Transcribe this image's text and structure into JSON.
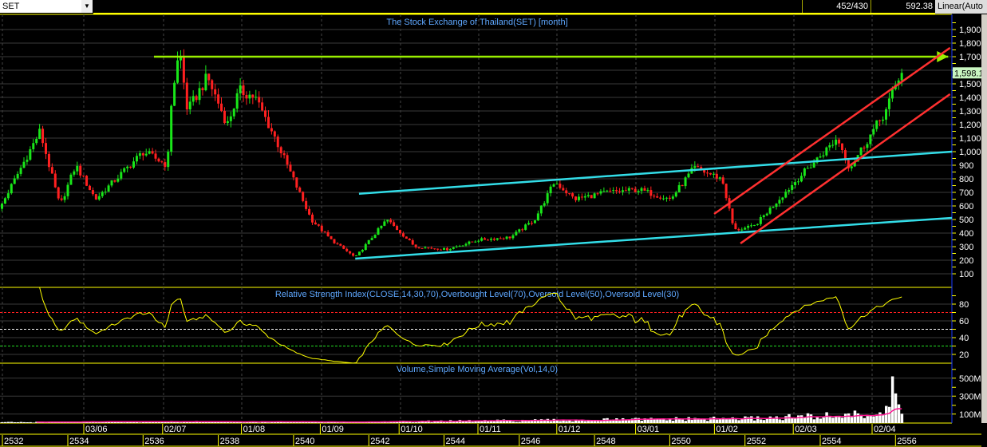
{
  "toolbar": {
    "symbol": "SET",
    "bars": "452/430",
    "value": "592.38",
    "scale": "Linear(Auto"
  },
  "colors": {
    "up": "#19e619",
    "down": "#ff2020",
    "grid": "#3a3a3a",
    "axis": "#ffff00",
    "trend_green": "#99ee00",
    "trend_cyan": "#33dde8",
    "trend_red": "#ff3030",
    "rsi": "#ffff00",
    "sma": "#ff1493"
  },
  "chart_data": [
    {
      "type": "candlestick",
      "title": "The Stock Exchange of Thailand(SET) [month]",
      "ylim": [
        0,
        1950
      ],
      "yticks": [
        "100",
        "200",
        "300",
        "400",
        "500",
        "600",
        "700",
        "800",
        "900",
        "1,000",
        "1,100",
        "1,200",
        "1,300",
        "1,400",
        "1,500",
        "1,600",
        "1,700",
        "1,800",
        "1,900"
      ],
      "last_price_label": "1,598.1",
      "path": [
        [
          2532.0,
          520
        ],
        [
          2532.09,
          530
        ],
        [
          2533.26,
          1150
        ],
        [
          2533.79,
          600
        ],
        [
          2534.21,
          900
        ],
        [
          2534.74,
          650
        ],
        [
          2536.01,
          1000
        ],
        [
          2536.65,
          900
        ],
        [
          2536.76,
          1400
        ],
        [
          2536.97,
          1750
        ],
        [
          2537.18,
          1300
        ],
        [
          2537.71,
          1550
        ],
        [
          2538.24,
          1200
        ],
        [
          2538.56,
          1450
        ],
        [
          2538.98,
          1400
        ],
        [
          2539.51,
          1100
        ],
        [
          2539.83,
          900
        ],
        [
          2540.47,
          500
        ],
        [
          2541.0,
          350
        ],
        [
          2541.64,
          220
        ],
        [
          2542.48,
          500
        ],
        [
          2543.23,
          300
        ],
        [
          2544.07,
          280
        ],
        [
          2544.92,
          350
        ],
        [
          2545.77,
          370
        ],
        [
          2546.41,
          500
        ],
        [
          2546.94,
          780
        ],
        [
          2547.47,
          650
        ],
        [
          2548.32,
          700
        ],
        [
          2549.17,
          720
        ],
        [
          2550.02,
          650
        ],
        [
          2550.65,
          880
        ],
        [
          2551.39,
          800
        ],
        [
          2551.71,
          420
        ],
        [
          2552.24,
          450
        ],
        [
          2553.4,
          800
        ],
        [
          2554.46,
          1100
        ],
        [
          2554.78,
          880
        ],
        [
          2555.74,
          1300
        ],
        [
          2556.16,
          1598
        ]
      ],
      "trendlines": [
        {
          "name": "resistance-1700",
          "color": "trend_green",
          "from": [
            2536.29,
            1700
          ],
          "to": [
            2557.4,
            1700
          ],
          "arrow": true
        },
        {
          "name": "channel-upper-cyan",
          "color": "trend_cyan",
          "from": [
            2541.74,
            690
          ],
          "to": [
            2557.5,
            1000
          ]
        },
        {
          "name": "channel-lower-cyan",
          "color": "trend_cyan",
          "from": [
            2541.64,
            212
          ],
          "to": [
            2557.5,
            512
          ]
        },
        {
          "name": "channel-upper-red",
          "color": "trend_red",
          "from": [
            2551.18,
            541
          ],
          "to": [
            2557.45,
            1765
          ]
        },
        {
          "name": "channel-lower-red",
          "color": "trend_red",
          "from": [
            2551.88,
            324
          ],
          "to": [
            2557.45,
            1424
          ]
        }
      ]
    },
    {
      "type": "line",
      "title": "Relative Strength Index(CLOSE,14,30,70),Overbought Level(70),Oversold Level(50),Oversold Level(30)",
      "period": 14,
      "levels": [
        70,
        50,
        30
      ],
      "ylim": [
        0,
        100
      ],
      "yticks": [
        "20",
        "40",
        "60",
        "80"
      ]
    },
    {
      "type": "bar",
      "title": "Volume,Simple Moving Average(Vol,14,0)",
      "unit": "M",
      "sma_period": 14,
      "yticks": [
        "100M",
        "300M",
        "500M"
      ],
      "path": [
        [
          2532,
          8
        ],
        [
          2537,
          15
        ],
        [
          2541,
          10
        ],
        [
          2546,
          25
        ],
        [
          2549,
          35
        ],
        [
          2552,
          45
        ],
        [
          2554,
          70
        ],
        [
          2555.5,
          90
        ],
        [
          2556.16,
          150
        ]
      ],
      "spikes": [
        [
          2555.9,
          520
        ],
        [
          2556.0,
          330
        ],
        [
          2555.8,
          180
        ]
      ]
    }
  ],
  "xaxis": {
    "dates": [
      "03/06",
      "02/07",
      "01/08",
      "01/09",
      "01/10",
      "01/11",
      "01/12",
      "03/01",
      "01/02",
      "02/03",
      "02/04"
    ],
    "years": [
      "2532",
      "2534",
      "2536",
      "2538",
      "2540",
      "2542",
      "2544",
      "2546",
      "2548",
      "2550",
      "2552",
      "2554",
      "2556"
    ]
  }
}
